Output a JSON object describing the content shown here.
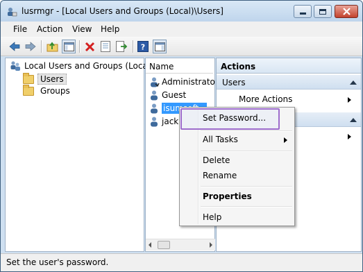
{
  "window": {
    "title": "lusrmgr - [Local Users and Groups (Local)\\Users]"
  },
  "menu": [
    "File",
    "Action",
    "View",
    "Help"
  ],
  "toolbar_icons": [
    "back-arrow-icon",
    "forward-arrow-icon",
    "up-folder-icon",
    "show-hide-console-tree-icon",
    "delete-icon",
    "properties-icon",
    "export-list-icon",
    "help-icon",
    "show-hide-action-pane-icon"
  ],
  "tree": {
    "root": "Local Users and Groups (Local)",
    "children": [
      "Users",
      "Groups"
    ],
    "selected": "Users"
  },
  "list": {
    "header": "Name",
    "items": [
      "Administrator",
      "Guest",
      "isumsoft",
      "jack"
    ],
    "selected": "isumsoft"
  },
  "actions": {
    "header": "Actions",
    "section1": "Users",
    "section1_item": "More Actions"
  },
  "context_menu": {
    "set_password": "Set Password...",
    "all_tasks": "All Tasks",
    "delete": "Delete",
    "rename": "Rename",
    "properties": "Properties",
    "help": "Help"
  },
  "status": "Set the user's password.",
  "colors": {
    "highlight_border": "#9d6ccc",
    "selection": "#3399ff"
  }
}
